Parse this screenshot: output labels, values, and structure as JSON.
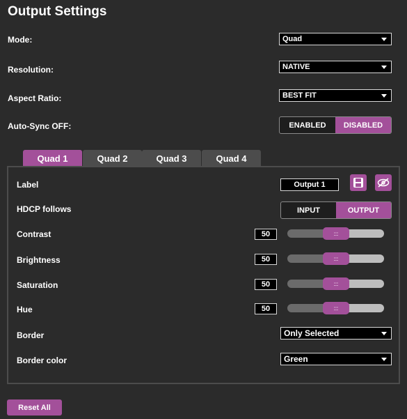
{
  "page_title": "Output Settings",
  "mode": {
    "label": "Mode:",
    "value": "Quad"
  },
  "resolution": {
    "label": "Resolution:",
    "value": "NATIVE"
  },
  "aspect_ratio": {
    "label": "Aspect Ratio:",
    "value": "BEST FIT"
  },
  "auto_sync": {
    "label": "Auto-Sync OFF:",
    "options": [
      "ENABLED",
      "DISABLED"
    ],
    "selected": "DISABLED"
  },
  "tabs": [
    {
      "label": "Quad 1",
      "active": true
    },
    {
      "label": "Quad 2",
      "active": false
    },
    {
      "label": "Quad 3",
      "active": false
    },
    {
      "label": "Quad 4",
      "active": false
    }
  ],
  "panel": {
    "label": {
      "label": "Label",
      "value": "Output  1"
    },
    "hdcp": {
      "label": "HDCP follows",
      "options": [
        "INPUT",
        "OUTPUT"
      ],
      "selected": "OUTPUT"
    },
    "sliders": [
      {
        "label": "Contrast",
        "value": "50"
      },
      {
        "label": "Brightness",
        "value": "50"
      },
      {
        "label": "Saturation",
        "value": "50"
      },
      {
        "label": "Hue",
        "value": "50"
      }
    ],
    "slider_level": 0.5,
    "border": {
      "label": "Border",
      "value": "Only Selected"
    },
    "border_color": {
      "label": "Border color",
      "value": "Green"
    }
  },
  "reset_label": "Reset All",
  "colors": {
    "accent": "#a3509a",
    "background": "#2b2b2b",
    "tab_inactive": "#4c4c4c"
  },
  "icons": [
    "save-icon",
    "hide-icon"
  ]
}
